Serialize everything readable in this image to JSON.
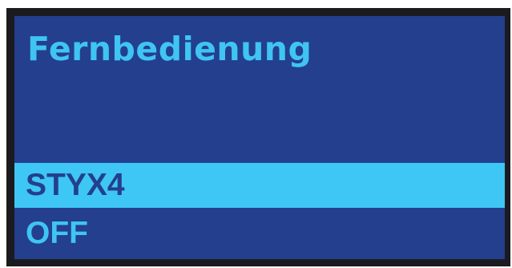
{
  "screen": {
    "title": "Fernbedienung"
  },
  "menu": {
    "items": [
      {
        "label": "STYX4",
        "selected": true
      },
      {
        "label": "OFF",
        "selected": false
      }
    ]
  },
  "colors": {
    "background": "#233f8d",
    "text": "#3fc4f3",
    "highlight": "#3ec6f4",
    "bezel": "#1b1b1f"
  }
}
